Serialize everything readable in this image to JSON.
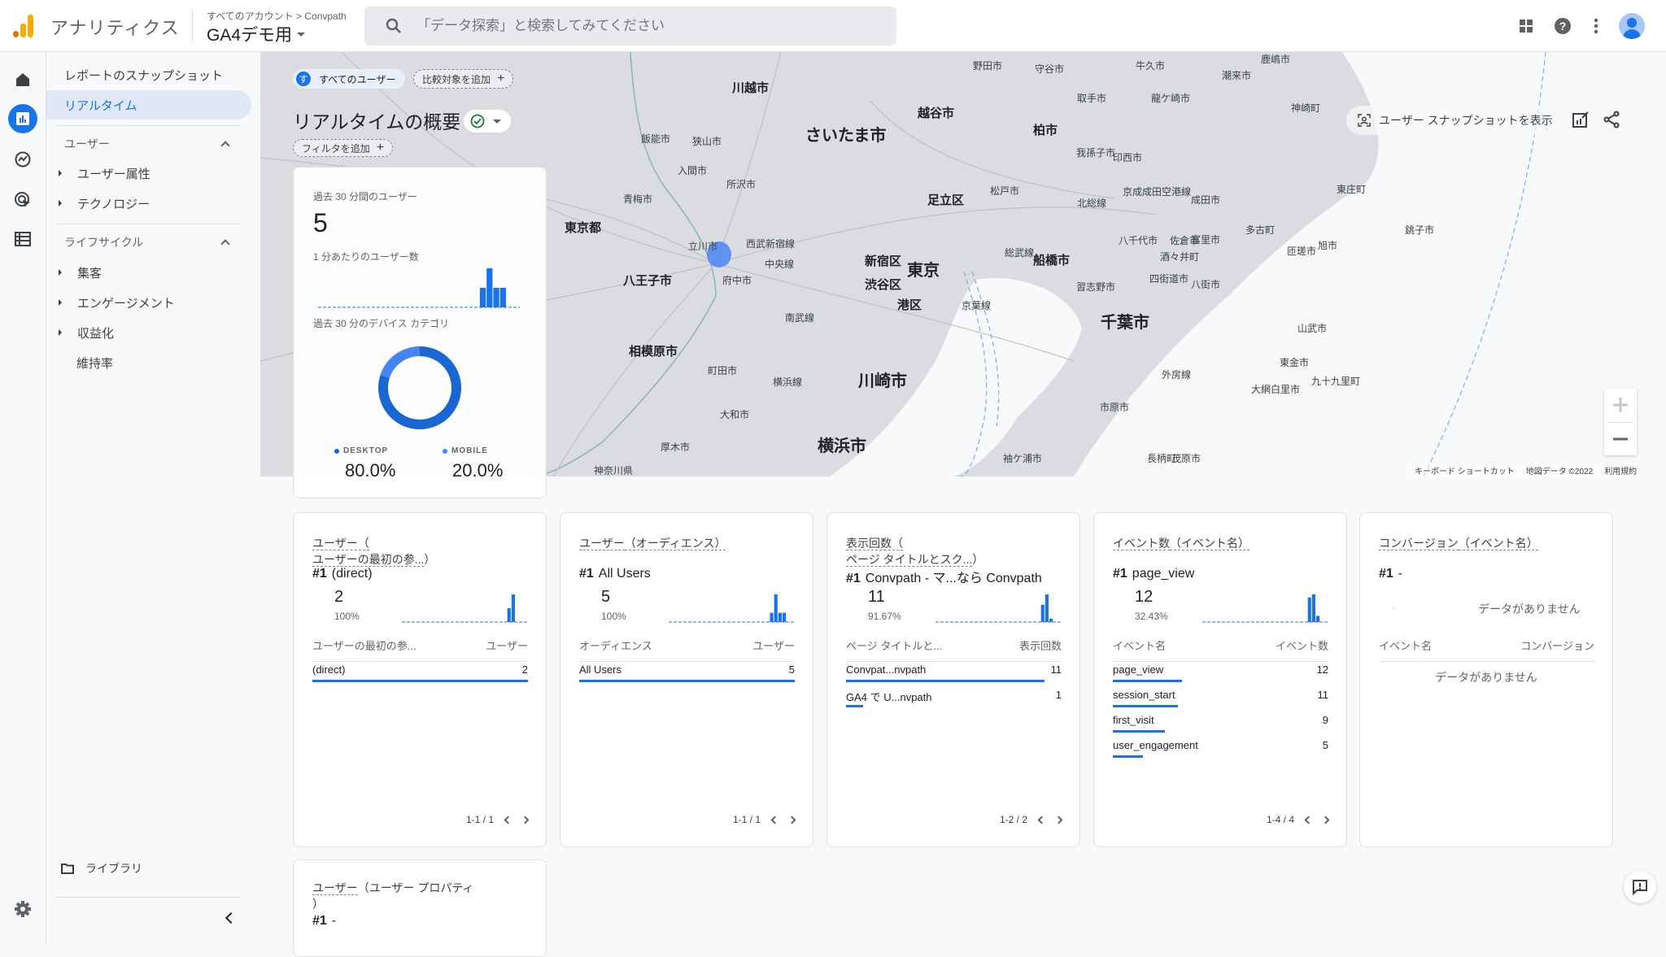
{
  "header": {
    "app_name": "アナリティクス",
    "breadcrumb": "すべてのアカウント > Convpath",
    "property": "GA4デモ用",
    "search_placeholder": "「データ探索」と検索してみてください",
    "icons": [
      "apps-icon",
      "help-icon",
      "more-vert-icon",
      "account-avatar"
    ]
  },
  "rail": {
    "items": [
      "home-icon",
      "reports-icon",
      "explore-icon",
      "advertising-icon",
      "configure-icon"
    ],
    "settings": "settings-icon"
  },
  "nav": {
    "snapshot": "レポートのスナップショット",
    "realtime": "リアルタイム",
    "user_section": "ユーザー",
    "user_items": [
      "ユーザー属性",
      "テクノロジー"
    ],
    "lifecycle_section": "ライフサイクル",
    "lifecycle_items": [
      "集客",
      "エンゲージメント",
      "収益化"
    ],
    "retention": "維持率",
    "library": "ライブラリ"
  },
  "toolbar": {
    "segment_badge": "す",
    "segment": "すべてのユーザー",
    "add_comparison": "比較対象を追加",
    "page_title": "リアルタイムの概要",
    "add_filter": "フィルタを追加",
    "snapshot_button": "ユーザー スナップショットを表示"
  },
  "map": {
    "labels": [
      {
        "t": "川越市",
        "c": "mid"
      },
      {
        "t": "さいたま市",
        "c": "big"
      },
      {
        "t": "越谷市",
        "c": "mid"
      },
      {
        "t": "柏市",
        "c": "mid"
      },
      {
        "t": "足立区",
        "c": "mid"
      },
      {
        "t": "東京都",
        "c": "mid"
      },
      {
        "t": "八王子市",
        "c": "mid"
      },
      {
        "t": "新宿区",
        "c": "mid"
      },
      {
        "t": "渋谷区",
        "c": "mid"
      },
      {
        "t": "東京",
        "c": "big"
      },
      {
        "t": "港区",
        "c": "mid"
      },
      {
        "t": "船橋市",
        "c": "mid"
      },
      {
        "t": "千葉市",
        "c": "big"
      },
      {
        "t": "相模原市",
        "c": "mid"
      },
      {
        "t": "川崎市",
        "c": "big"
      },
      {
        "t": "横浜市",
        "c": "big"
      },
      {
        "t": "野田市",
        "c": ""
      },
      {
        "t": "守谷市",
        "c": ""
      },
      {
        "t": "牛久市",
        "c": ""
      },
      {
        "t": "取手市",
        "c": ""
      },
      {
        "t": "龍ケ崎市",
        "c": ""
      },
      {
        "t": "潮来市",
        "c": ""
      },
      {
        "t": "鹿嶋市",
        "c": ""
      },
      {
        "t": "神崎町",
        "c": ""
      },
      {
        "t": "飯能市",
        "c": ""
      },
      {
        "t": "狭山市",
        "c": ""
      },
      {
        "t": "入間市",
        "c": ""
      },
      {
        "t": "所沢市",
        "c": ""
      },
      {
        "t": "青梅市",
        "c": ""
      },
      {
        "t": "立川市",
        "c": ""
      },
      {
        "t": "府中市",
        "c": ""
      },
      {
        "t": "松戸市",
        "c": ""
      },
      {
        "t": "我孫子市",
        "c": ""
      },
      {
        "t": "印西市",
        "c": ""
      },
      {
        "t": "成田市",
        "c": ""
      },
      {
        "t": "東庄町",
        "c": ""
      },
      {
        "t": "八千代市",
        "c": ""
      },
      {
        "t": "佐倉市",
        "c": ""
      },
      {
        "t": "酒々井町",
        "c": ""
      },
      {
        "t": "富里市",
        "c": ""
      },
      {
        "t": "多古町",
        "c": ""
      },
      {
        "t": "匝瑳市",
        "c": ""
      },
      {
        "t": "旭市",
        "c": ""
      },
      {
        "t": "銚子市",
        "c": ""
      },
      {
        "t": "習志野市",
        "c": ""
      },
      {
        "t": "四街道市",
        "c": ""
      },
      {
        "t": "八街市",
        "c": ""
      },
      {
        "t": "山武市",
        "c": ""
      },
      {
        "t": "東金市",
        "c": ""
      },
      {
        "t": "九十九里町",
        "c": ""
      },
      {
        "t": "大網白里市",
        "c": ""
      },
      {
        "t": "市原市",
        "c": ""
      },
      {
        "t": "長柄町",
        "c": ""
      },
      {
        "t": "茂原市",
        "c": ""
      },
      {
        "t": "袖ケ浦市",
        "c": ""
      },
      {
        "t": "町田市",
        "c": ""
      },
      {
        "t": "大和市",
        "c": ""
      },
      {
        "t": "厚木市",
        "c": ""
      },
      {
        "t": "神奈川県",
        "c": ""
      },
      {
        "t": "中央線",
        "c": ""
      },
      {
        "t": "西武新宿線",
        "c": ""
      },
      {
        "t": "南武線",
        "c": ""
      },
      {
        "t": "京葉線",
        "c": ""
      },
      {
        "t": "総武線",
        "c": ""
      },
      {
        "t": "北総線",
        "c": ""
      },
      {
        "t": "京成成田空港線",
        "c": ""
      },
      {
        "t": "外房線",
        "c": ""
      },
      {
        "t": "横浜線",
        "c": ""
      }
    ],
    "footer": [
      "キーボード ショートカット",
      "地図データ ©2022",
      "利用規約"
    ]
  },
  "overview": {
    "users_label": "過去 30 分間のユーザー",
    "users_value": "5",
    "per_min_label": "1 分あたりのユーザー数",
    "per_minute": [
      0,
      0,
      0,
      0,
      0,
      0,
      0,
      0,
      0,
      0,
      0,
      0,
      0,
      0,
      0,
      0,
      0,
      0,
      0,
      0,
      0,
      0,
      0,
      0,
      1,
      2,
      1,
      1,
      0,
      0
    ],
    "device_label": "過去 30 分のデバイス カテゴリ",
    "devices": [
      {
        "name": "DESKTOP",
        "pct": "80.0%",
        "value": 80.0,
        "color": "#1967d2"
      },
      {
        "name": "MOBILE",
        "pct": "20.0%",
        "value": 20.0,
        "color": "#4285f4"
      }
    ]
  },
  "cards": [
    {
      "title_a": "ユーザー（",
      "title_b": "ユーザーの最初の参...",
      "title_c": "）",
      "top_rank": "#1",
      "top_name": "(direct)",
      "value": "2",
      "pct": "100%",
      "spark": [
        0,
        0,
        0,
        0,
        0,
        0,
        0,
        0,
        0,
        0,
        0,
        0,
        0,
        0,
        0,
        0,
        0,
        0,
        0,
        0,
        0,
        0,
        0,
        0,
        0,
        1,
        2,
        0,
        0,
        0
      ],
      "col_a": "ユーザーの最初の参...",
      "col_b": "ユーザー",
      "rows": [
        {
          "name": "(direct)",
          "value": "2",
          "share": 1.0
        }
      ],
      "pager": "1-1 / 1"
    },
    {
      "title_a": "ユーザー",
      "title_b": "（オーディエンス）",
      "title_c": "",
      "top_rank": "#1",
      "top_name": "All Users",
      "value": "5",
      "pct": "100%",
      "spark": [
        0,
        0,
        0,
        0,
        0,
        0,
        0,
        0,
        0,
        0,
        0,
        0,
        0,
        0,
        0,
        0,
        0,
        0,
        0,
        0,
        0,
        0,
        0,
        0,
        1,
        3,
        1,
        1,
        0,
        0
      ],
      "col_a": "オーディエンス",
      "col_b": "ユーザー",
      "rows": [
        {
          "name": "All Users",
          "value": "5",
          "share": 1.0
        }
      ],
      "pager": "1-1 / 1"
    },
    {
      "title_a": "表示回数（",
      "title_b": "ページ タイトルとスク...",
      "title_c": "）",
      "top_rank": "#1",
      "top_name": "Convpath - マ...なら Convpath",
      "value": "11",
      "pct": "91.67%",
      "spark": [
        0,
        0,
        0,
        0,
        0,
        0,
        0,
        0,
        0,
        0,
        0,
        0,
        0,
        0,
        0,
        0,
        0,
        0,
        0,
        0,
        0,
        0,
        0,
        0,
        0,
        5,
        8,
        1,
        0,
        0
      ],
      "col_a": "ページ タイトルと...",
      "col_b": "表示回数",
      "rows": [
        {
          "name": "Convpat...nvpath",
          "value": "11",
          "share": 0.92
        },
        {
          "name": "GA4 で U...nvpath",
          "value": "1",
          "share": 0.08
        }
      ],
      "pager": "1-2 / 2"
    },
    {
      "title_a": "イベント数",
      "title_b": "（イベント名）",
      "title_c": "",
      "top_rank": "#1",
      "top_name": "page_view",
      "value": "12",
      "pct": "32.43%",
      "spark": [
        0,
        0,
        0,
        0,
        0,
        0,
        0,
        0,
        0,
        0,
        0,
        0,
        0,
        0,
        0,
        0,
        0,
        0,
        0,
        0,
        0,
        0,
        0,
        0,
        0,
        8,
        9,
        2,
        0,
        0
      ],
      "col_a": "イベント名",
      "col_b": "イベント数",
      "rows": [
        {
          "name": "page_view",
          "value": "12",
          "share": 0.32
        },
        {
          "name": "session_start",
          "value": "11",
          "share": 0.3
        },
        {
          "name": "first_visit",
          "value": "9",
          "share": 0.24
        },
        {
          "name": "user_engagement",
          "value": "5",
          "share": 0.14
        }
      ],
      "pager": "1-4 / 4"
    },
    {
      "title_a": "コンバージョン",
      "title_b": "（イベント名）",
      "title_c": "",
      "top_rank": "#1",
      "top_name": "-",
      "value": "-",
      "pct": "",
      "no_data": "データがありません",
      "col_a": "イベント名",
      "col_b": "コンバージョン",
      "rows": [],
      "pager": ""
    }
  ],
  "bottom_card": {
    "title_a": "ユーザー",
    "title_b": "（ユーザー プロパティ",
    "title_c": "）",
    "top_rank": "#1",
    "top_name": "-"
  },
  "colors": {
    "accent": "#1a73e8",
    "desktop": "#1967d2",
    "mobile": "#4285f4",
    "map_land": "#dadce0",
    "map_sea": "#f8f9fa",
    "active_user_marker": "#4a85f5"
  }
}
